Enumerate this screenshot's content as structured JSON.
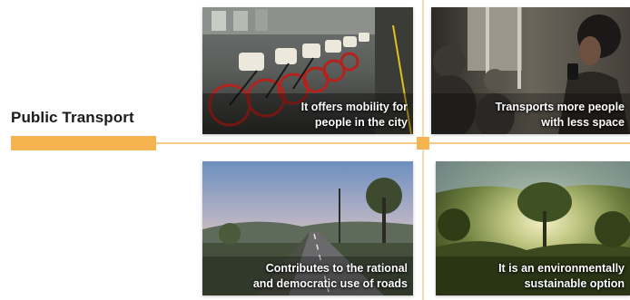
{
  "slide": {
    "title": "Public Transport",
    "accent_color": "#f6b450"
  },
  "cards": [
    {
      "id": "bikes",
      "image": "bike-sharing-station-photo",
      "caption_lines": [
        "It offers mobility for",
        "people in the city"
      ]
    },
    {
      "id": "train",
      "image": "commuters-on-train-photo",
      "caption_lines": [
        "Transports more people",
        "with less space"
      ]
    },
    {
      "id": "road",
      "image": "highway-at-sunset-photo",
      "caption_lines": [
        "Contributes to the rational",
        "and democratic use of roads"
      ]
    },
    {
      "id": "forest",
      "image": "sunlit-forest-photo",
      "caption_lines": [
        "It is an environmentally",
        "sustainable option"
      ]
    }
  ]
}
